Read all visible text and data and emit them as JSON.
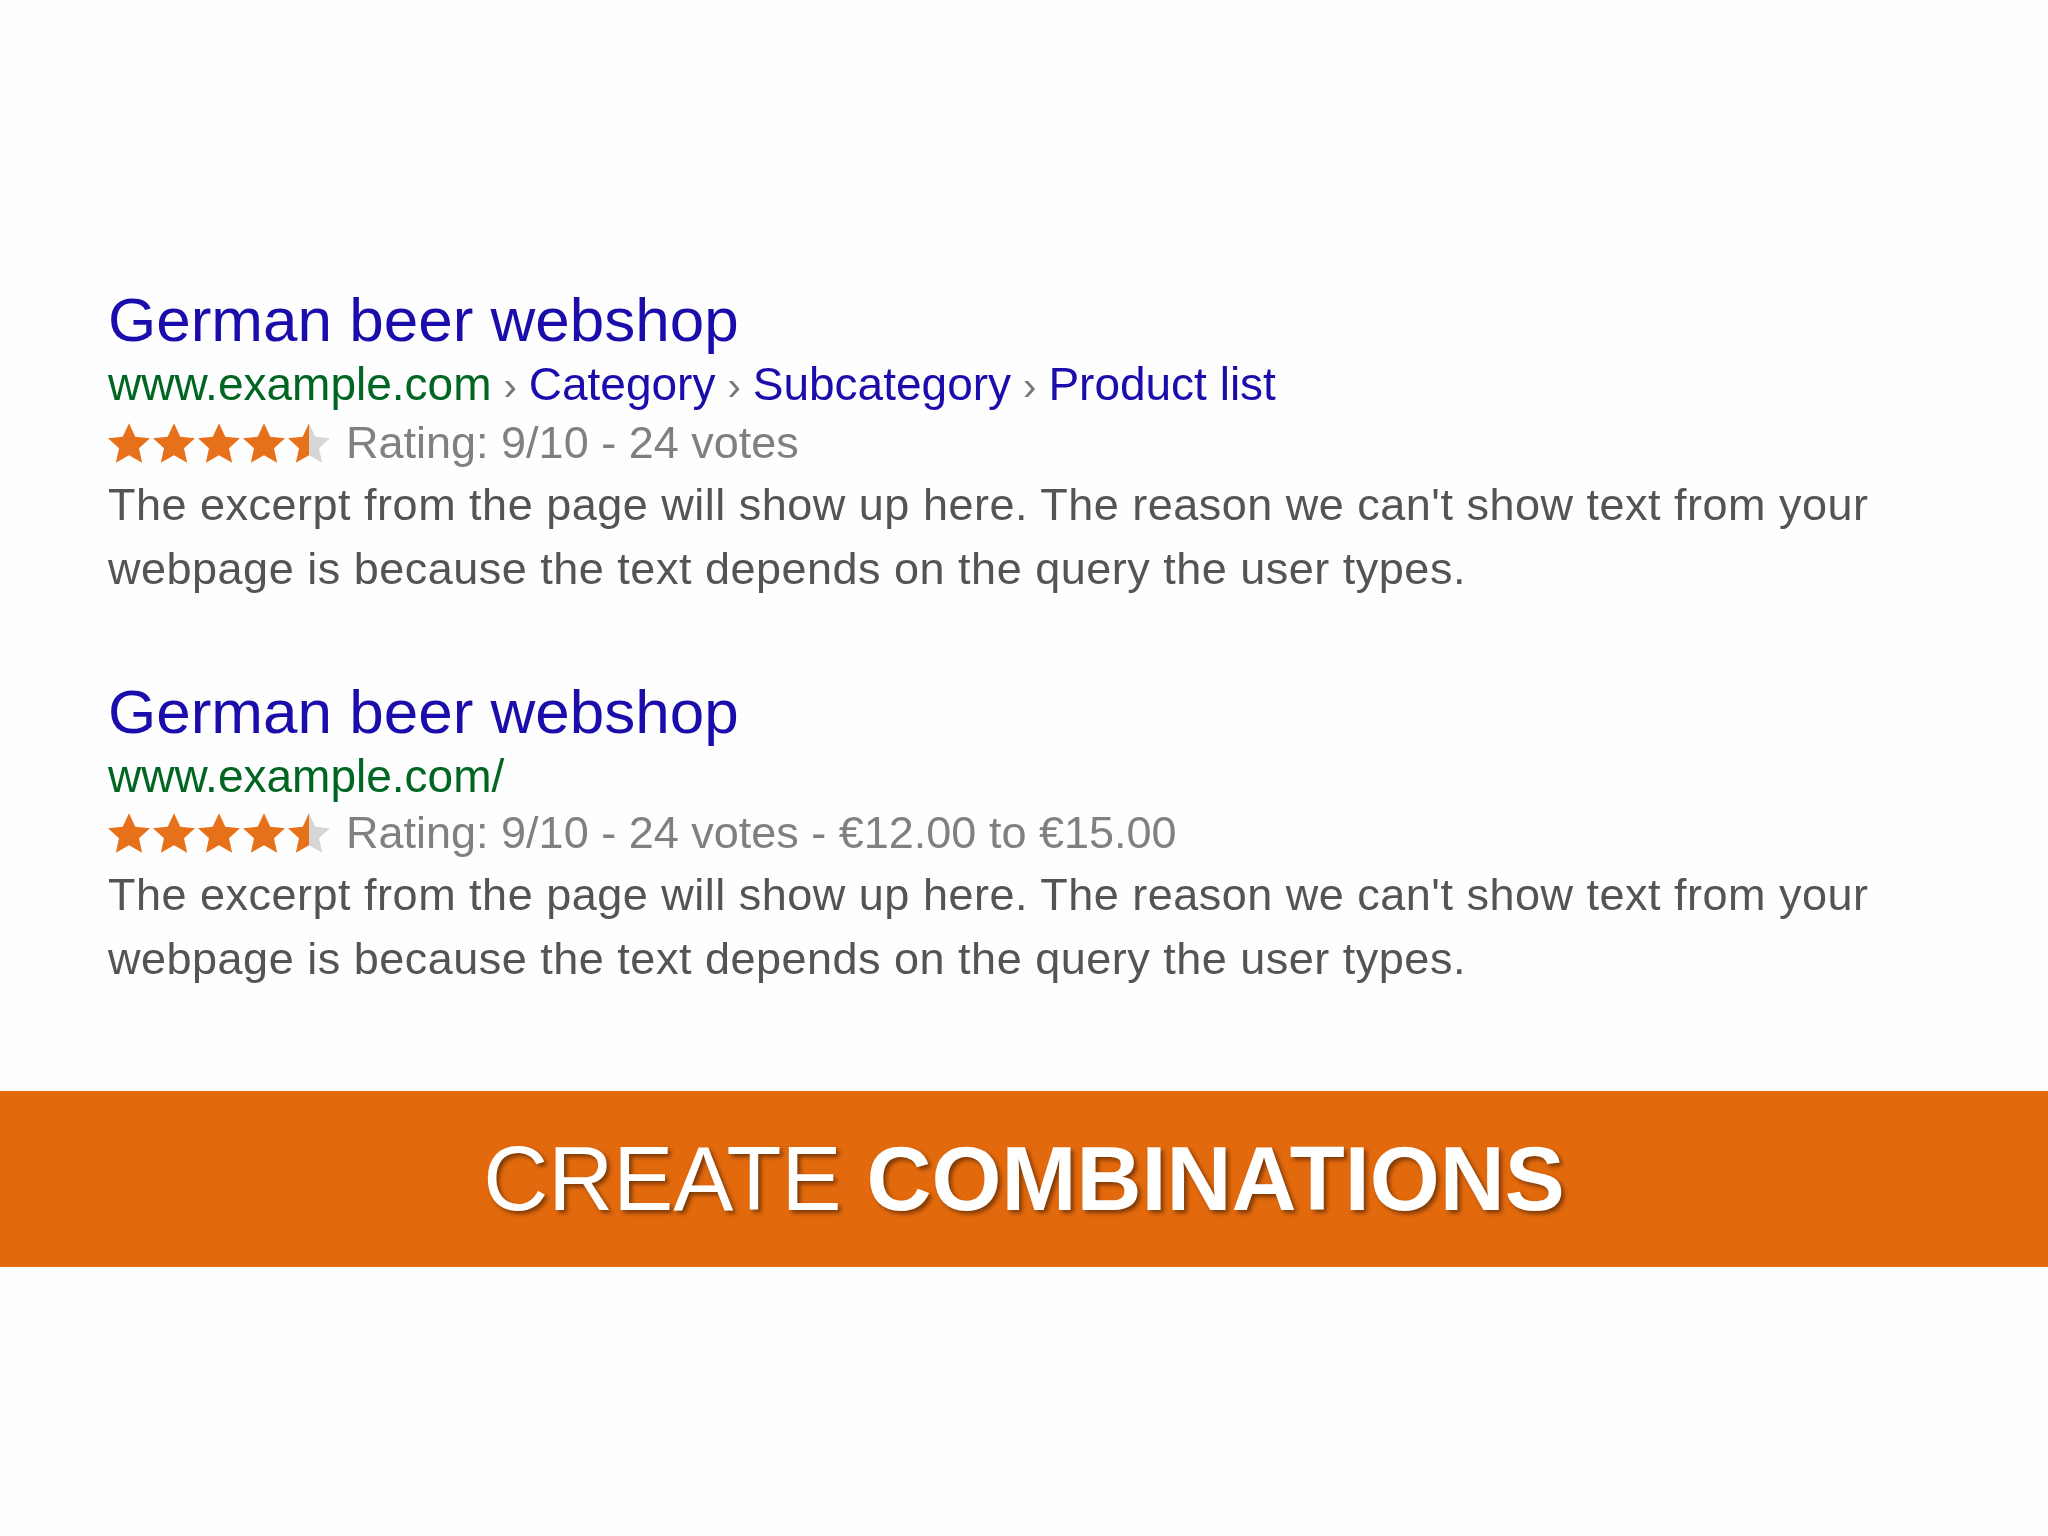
{
  "search_results": [
    {
      "title": "German beer webshop",
      "url_segments": [
        {
          "kind": "domain",
          "text": "www.example.com"
        },
        {
          "kind": "separator",
          "text": "›"
        },
        {
          "kind": "link",
          "text": "Category"
        },
        {
          "kind": "separator",
          "text": "›"
        },
        {
          "kind": "link",
          "text": "Subcategory"
        },
        {
          "kind": "separator",
          "text": "›"
        },
        {
          "kind": "link",
          "text": "Product list"
        }
      ],
      "stars": 4.5,
      "rating_text": "Rating: 9/10 - 24 votes",
      "snippet": "The excerpt from the page will show up here. The reason we can't show text from your webpage is because the text depends on the query the user types."
    },
    {
      "title": "German beer webshop",
      "url_segments": [
        {
          "kind": "domain",
          "text": "www.example.com/"
        }
      ],
      "stars": 4.5,
      "rating_text": "Rating: 9/10 - 24 votes - €12.00 to €15.00",
      "snippet": "The excerpt from the page will show up here. The reason we can't show text from your webpage is because the text depends on the query the user types."
    }
  ],
  "banner": {
    "text": "CREATE **COMBINATIONS**"
  }
}
